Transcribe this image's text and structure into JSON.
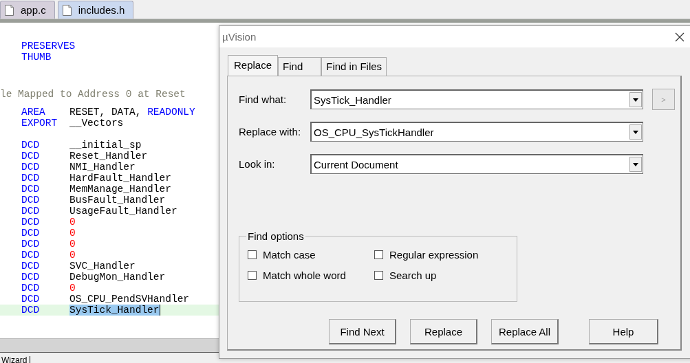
{
  "editor": {
    "tabs": [
      {
        "label": "app.c",
        "selected": false
      },
      {
        "label": "includes.h",
        "selected": true
      }
    ],
    "lines": [
      {
        "kind": "code",
        "current": false,
        "keyword": "PRESERVES"
      },
      {
        "kind": "code",
        "current": false,
        "keyword": "THUMB"
      },
      {
        "kind": "blank"
      },
      {
        "kind": "blank"
      },
      {
        "kind": "comment",
        "text": "le Mapped to Address 0 at Reset"
      },
      {
        "kind": "blank"
      },
      {
        "kind": "code",
        "current": false,
        "keyword": "AREA",
        "args": [
          {
            "text": "RESET, DATA, ",
            "kind": "plain",
            "selected": false
          },
          {
            "text": "READONLY",
            "kind": "keyword",
            "selected": false
          }
        ]
      },
      {
        "kind": "code",
        "current": false,
        "keyword": "EXPORT",
        "args": [
          {
            "text": "__Vectors",
            "kind": "plain",
            "selected": false
          }
        ]
      },
      {
        "kind": "blank"
      },
      {
        "kind": "code",
        "current": false,
        "keyword": "DCD",
        "args": [
          {
            "text": "__initial_sp",
            "kind": "plain",
            "selected": false
          }
        ]
      },
      {
        "kind": "code",
        "current": false,
        "keyword": "DCD",
        "args": [
          {
            "text": "Reset_Handler",
            "kind": "plain",
            "selected": false
          }
        ]
      },
      {
        "kind": "code",
        "current": false,
        "keyword": "DCD",
        "args": [
          {
            "text": "NMI_Handler",
            "kind": "plain",
            "selected": false
          }
        ]
      },
      {
        "kind": "code",
        "current": false,
        "keyword": "DCD",
        "args": [
          {
            "text": "HardFault_Handler",
            "kind": "plain",
            "selected": false
          }
        ]
      },
      {
        "kind": "code",
        "current": false,
        "keyword": "DCD",
        "args": [
          {
            "text": "MemManage_Handler",
            "kind": "plain",
            "selected": false
          }
        ]
      },
      {
        "kind": "code",
        "current": false,
        "keyword": "DCD",
        "args": [
          {
            "text": "BusFault_Handler",
            "kind": "plain",
            "selected": false
          }
        ]
      },
      {
        "kind": "code",
        "current": false,
        "keyword": "DCD",
        "args": [
          {
            "text": "UsageFault_Handler",
            "kind": "plain",
            "selected": false
          }
        ]
      },
      {
        "kind": "code",
        "current": false,
        "keyword": "DCD",
        "args": [
          {
            "text": "0",
            "kind": "number",
            "selected": false
          }
        ]
      },
      {
        "kind": "code",
        "current": false,
        "keyword": "DCD",
        "args": [
          {
            "text": "0",
            "kind": "number",
            "selected": false
          }
        ]
      },
      {
        "kind": "code",
        "current": false,
        "keyword": "DCD",
        "args": [
          {
            "text": "0",
            "kind": "number",
            "selected": false
          }
        ]
      },
      {
        "kind": "code",
        "current": false,
        "keyword": "DCD",
        "args": [
          {
            "text": "0",
            "kind": "number",
            "selected": false
          }
        ]
      },
      {
        "kind": "code",
        "current": false,
        "keyword": "DCD",
        "args": [
          {
            "text": "SVC_Handler",
            "kind": "plain",
            "selected": false
          }
        ]
      },
      {
        "kind": "code",
        "current": false,
        "keyword": "DCD",
        "args": [
          {
            "text": "DebugMon_Handler",
            "kind": "plain",
            "selected": false
          }
        ]
      },
      {
        "kind": "code",
        "current": false,
        "keyword": "DCD",
        "args": [
          {
            "text": "0",
            "kind": "number",
            "selected": false
          }
        ]
      },
      {
        "kind": "code",
        "current": false,
        "keyword": "DCD",
        "args": [
          {
            "text": "OS_CPU_PendSVHandler",
            "kind": "plain",
            "selected": false
          }
        ]
      },
      {
        "kind": "code",
        "current": true,
        "keyword": "DCD",
        "args": [
          {
            "text": "SysTick_Handler",
            "kind": "plain",
            "selected": true
          }
        ]
      }
    ],
    "bottom_tab": "Wizard"
  },
  "dialog": {
    "title": "µVision",
    "tabs": [
      {
        "label": "Replace",
        "selected": true
      },
      {
        "label": "Find",
        "selected": false
      },
      {
        "label": "Find in Files",
        "selected": false
      }
    ],
    "fields": [
      {
        "label": "Find what:",
        "value": "SysTick_Handler",
        "side_button": {
          "label": ">",
          "disabled": true
        }
      },
      {
        "label": "Replace with:",
        "value": "OS_CPU_SysTickHandler"
      },
      {
        "label": "Look in:",
        "value": "Current Document"
      }
    ],
    "options": {
      "title": "Find options",
      "checkboxes": [
        {
          "label": "Match case",
          "checked": false
        },
        {
          "label": "Regular expression",
          "checked": false
        },
        {
          "label": "Match whole word",
          "checked": false
        },
        {
          "label": "Search up",
          "checked": false
        }
      ]
    },
    "buttons": [
      "Find Next",
      "Replace",
      "Replace All",
      "Help"
    ]
  }
}
